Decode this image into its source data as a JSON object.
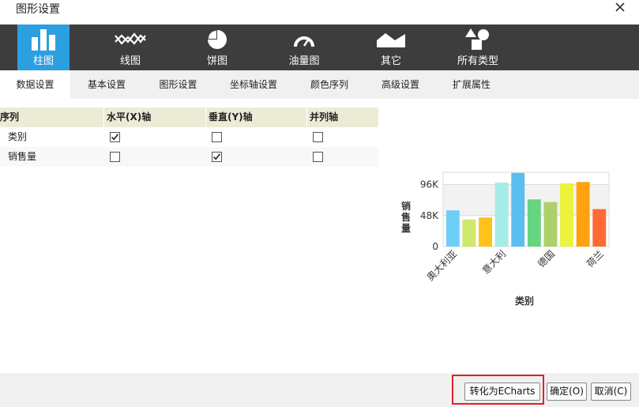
{
  "dialog": {
    "title": "图形设置",
    "close_icon": "close-icon"
  },
  "chart_types": [
    {
      "label": "柱图",
      "icon": "bar-chart-icon",
      "active": true
    },
    {
      "label": "线图",
      "icon": "line-chart-icon",
      "active": false
    },
    {
      "label": "饼图",
      "icon": "pie-chart-icon",
      "active": false
    },
    {
      "label": "油量图",
      "icon": "gauge-chart-icon",
      "active": false
    },
    {
      "label": "其它",
      "icon": "area-chart-icon",
      "active": false
    },
    {
      "label": "所有类型",
      "icon": "all-types-icon",
      "active": false
    }
  ],
  "tabs": [
    {
      "label": "数据设置",
      "active": true
    },
    {
      "label": "基本设置",
      "active": false
    },
    {
      "label": "图形设置",
      "active": false
    },
    {
      "label": "坐标轴设置",
      "active": false
    },
    {
      "label": "颜色序列",
      "active": false
    },
    {
      "label": "高级设置",
      "active": false
    },
    {
      "label": "扩展属性",
      "active": false
    }
  ],
  "grid": {
    "headers": [
      "序列",
      "水平(X)轴",
      "垂直(Y)轴",
      "并列轴"
    ],
    "rows": [
      {
        "name": "类别",
        "x": true,
        "y": false,
        "parallel": false
      },
      {
        "name": "销售量",
        "x": false,
        "y": true,
        "parallel": false
      }
    ]
  },
  "chart_data": {
    "type": "bar",
    "xlabel": "类别",
    "ylabel": "销售量",
    "yticks": [
      "0",
      "48K",
      "96K"
    ],
    "ylim": [
      0,
      115000
    ],
    "xticks": [
      "奥大利亚",
      "意大利",
      "德国",
      "荷兰"
    ],
    "values": [
      56000,
      42000,
      45000,
      99000,
      114000,
      73000,
      69000,
      98000,
      100000,
      58000
    ],
    "colors": [
      "#6ecff6",
      "#cde86a",
      "#ffc21a",
      "#a6ece6",
      "#5cbdf0",
      "#67d47f",
      "#aed06a",
      "#edf23c",
      "#ffa20d",
      "#ff6b35"
    ],
    "grid": true
  },
  "footer": {
    "convert_label": "转化为ECharts",
    "ok_label": "确定(O)",
    "cancel_label": "取消(C)"
  }
}
